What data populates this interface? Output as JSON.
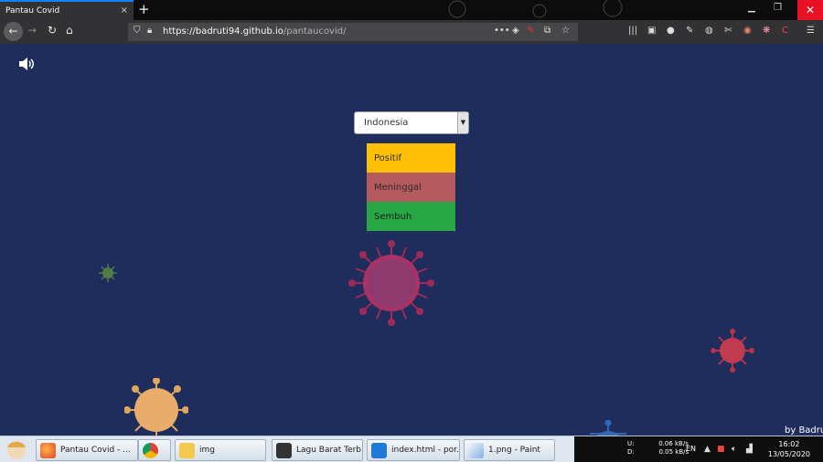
{
  "browser": {
    "tab_title": "Pantau Covid",
    "tab_close": "×",
    "new_tab": "+",
    "url_host": "https://badruti94.github.io",
    "url_path": "/pantaucovid/",
    "url_overflow": "•••"
  },
  "page": {
    "country_select": {
      "value": "Indonesia"
    },
    "stats": [
      {
        "label": "Positif",
        "color": "#ffc107"
      },
      {
        "label": "Meninggal",
        "color": "#b55a5c"
      },
      {
        "label": "Sembuh",
        "color": "#28a745"
      }
    ],
    "byline": "by Badru"
  },
  "taskbar": {
    "tasks": [
      {
        "label": "Pantau Covid - ...",
        "icon": "firefox-icon"
      },
      {
        "label": "",
        "icon": "chrome-icon"
      },
      {
        "label": "img",
        "icon": "folder-icon"
      },
      {
        "label": "Lagu Barat Terb...",
        "icon": "media-player-icon"
      },
      {
        "label": "index.html - por...",
        "icon": "vscode-icon"
      },
      {
        "label": "1.png - Paint",
        "icon": "paint-icon"
      }
    ],
    "network": {
      "up_label": "U:",
      "up_value": "0.06 kB/s",
      "down_label": "D:",
      "down_value": "0.05 kB/s"
    },
    "language": "EN",
    "time": "16:02",
    "date": "13/05/2020"
  }
}
